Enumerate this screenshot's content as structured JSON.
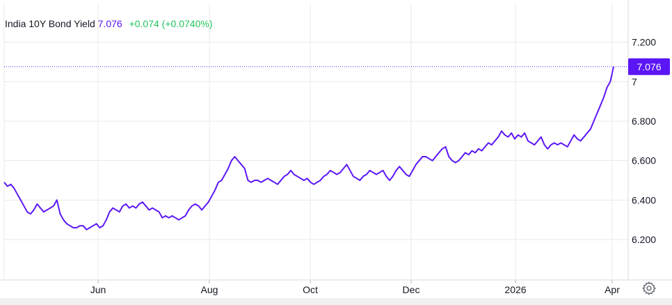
{
  "legend": {
    "title": "India 10Y Bond Yield",
    "last_value": "7.076",
    "change": "+0.074 (+0.0740%)"
  },
  "price_tag": "7.076",
  "settings_icon": "gear-icon",
  "colors": {
    "line": "#5b16f5",
    "tag": "#5b16f5",
    "grid": "#e8e8e8",
    "positive": "#22c55e",
    "text": "#131722"
  },
  "chart_data": {
    "type": "line",
    "title": "India 10Y Bond Yield",
    "xlabel": "",
    "ylabel": "",
    "x_ticks": [
      "Jun",
      "Aug",
      "Oct",
      "Dec",
      "2026",
      "Apr"
    ],
    "y_ticks": [
      "6.200",
      "6.400",
      "6.600",
      "6.800",
      "7",
      "7.200"
    ],
    "ylim": [
      6.0,
      7.3
    ],
    "grid": true,
    "last_value": 7.076,
    "series": [
      {
        "name": "",
        "values": [
          6.49,
          6.47,
          6.48,
          6.46,
          6.43,
          6.4,
          6.37,
          6.34,
          6.33,
          6.35,
          6.38,
          6.36,
          6.34,
          6.35,
          6.36,
          6.37,
          6.4,
          6.33,
          6.3,
          6.28,
          6.27,
          6.26,
          6.26,
          6.27,
          6.27,
          6.25,
          6.26,
          6.27,
          6.28,
          6.26,
          6.27,
          6.3,
          6.34,
          6.36,
          6.35,
          6.34,
          6.37,
          6.38,
          6.36,
          6.37,
          6.36,
          6.38,
          6.39,
          6.37,
          6.35,
          6.36,
          6.35,
          6.34,
          6.31,
          6.32,
          6.31,
          6.32,
          6.31,
          6.3,
          6.31,
          6.32,
          6.35,
          6.37,
          6.38,
          6.37,
          6.35,
          6.37,
          6.39,
          6.42,
          6.45,
          6.49,
          6.5,
          6.53,
          6.56,
          6.6,
          6.62,
          6.6,
          6.58,
          6.56,
          6.5,
          6.49,
          6.5,
          6.5,
          6.49,
          6.5,
          6.51,
          6.5,
          6.49,
          6.48,
          6.5,
          6.52,
          6.53,
          6.55,
          6.53,
          6.52,
          6.51,
          6.5,
          6.51,
          6.49,
          6.48,
          6.49,
          6.5,
          6.52,
          6.53,
          6.55,
          6.54,
          6.53,
          6.54,
          6.56,
          6.58,
          6.55,
          6.52,
          6.51,
          6.5,
          6.52,
          6.53,
          6.55,
          6.54,
          6.53,
          6.54,
          6.55,
          6.52,
          6.5,
          6.52,
          6.55,
          6.57,
          6.55,
          6.53,
          6.52,
          6.55,
          6.58,
          6.6,
          6.62,
          6.62,
          6.61,
          6.6,
          6.62,
          6.64,
          6.66,
          6.67,
          6.62,
          6.6,
          6.59,
          6.6,
          6.62,
          6.64,
          6.63,
          6.65,
          6.64,
          6.66,
          6.65,
          6.67,
          6.69,
          6.68,
          6.7,
          6.72,
          6.75,
          6.73,
          6.72,
          6.74,
          6.71,
          6.73,
          6.72,
          6.74,
          6.7,
          6.69,
          6.68,
          6.7,
          6.72,
          6.68,
          6.66,
          6.68,
          6.69,
          6.68,
          6.69,
          6.68,
          6.67,
          6.7,
          6.73,
          6.71,
          6.7,
          6.72,
          6.74,
          6.76,
          6.8,
          6.84,
          6.88,
          6.92,
          6.97,
          7.0,
          7.076
        ]
      }
    ]
  }
}
